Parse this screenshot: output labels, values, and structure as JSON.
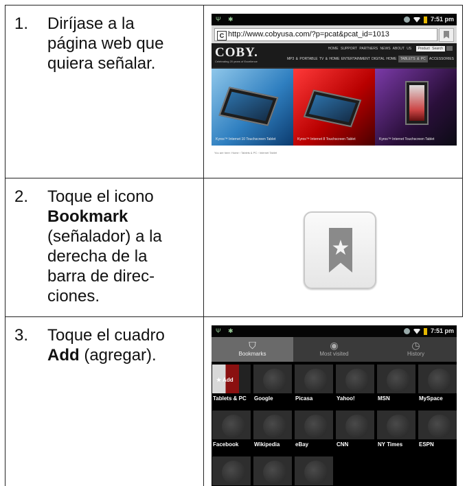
{
  "steps": [
    {
      "number": "1.",
      "text_lines": [
        "Diríjase a la",
        "página web que",
        "quiera señalar."
      ]
    },
    {
      "number": "2.",
      "text_pre": "Toque el icono",
      "text_bold": "Bookmark",
      "text_post_lines": [
        "(señalador) a la",
        "derecha de la",
        "barra de direc-",
        "ciones."
      ]
    },
    {
      "number": "3.",
      "text_pre": "Toque el cuadro",
      "text_bold": "Add",
      "text_post": " (agregar)."
    }
  ],
  "browser": {
    "status_time": "7:51 pm",
    "url_prefix": "C",
    "url": "http://www.cobyusa.com/?p=pcat&pcat_id=1013",
    "site": {
      "logo": "COBY.",
      "tagline": "Celebrating 20 years of Excellence",
      "top_nav": [
        "HOME",
        "SUPPORT",
        "PARTNERS",
        "NEWS",
        "ABOUT US"
      ],
      "search_label": "Product Search",
      "main_nav": [
        "MP3 & PORTABLE",
        "TV & HOME ENTERTAINMENT",
        "DIGITAL HOME",
        "TABLETS & PC",
        "ACCESSORIES"
      ],
      "banners": [
        "Kyros™ Internet 10 Touchscreen Tablet",
        "Kyros™ Internet 8 Touchscreen Tablet",
        "Kyros™ Internet Touchscreen Tablet"
      ],
      "breadcrumb": "You are here: Home › Tablets & PC › Internet Tablet"
    }
  },
  "bookmarks": {
    "status_time": "7:51 pm",
    "tabs": [
      "Bookmarks",
      "Most visited",
      "History"
    ],
    "add_label": "Add",
    "items": [
      "Tablets & PC",
      "Google",
      "Picasa",
      "Yahoo!",
      "MSN",
      "MySpace",
      "Facebook",
      "Wikipedia",
      "eBay",
      "CNN",
      "NY Times",
      "ESPN",
      "",
      "",
      ""
    ]
  }
}
